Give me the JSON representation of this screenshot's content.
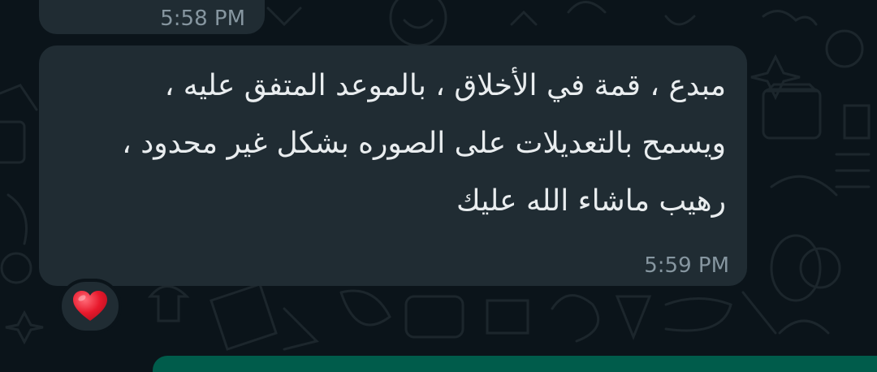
{
  "previous_message": {
    "time": "5:58 PM"
  },
  "message": {
    "lines": [
      "مبدع ، قمة في الأخلاق ، بالموعد المتفق عليه ،",
      "ويسمح بالتعديلات على الصوره بشكل غير محدود ،",
      "رهيب ماشاء الله عليك"
    ],
    "time": "5:59 PM",
    "reaction": "heart-icon"
  },
  "colors": {
    "background": "#0b141a",
    "incoming_bubble": "#202c33",
    "outgoing_bubble": "#005c4b",
    "text": "#e9edef",
    "timestamp": "#8696a0",
    "reaction_heart": "#e8192c"
  }
}
